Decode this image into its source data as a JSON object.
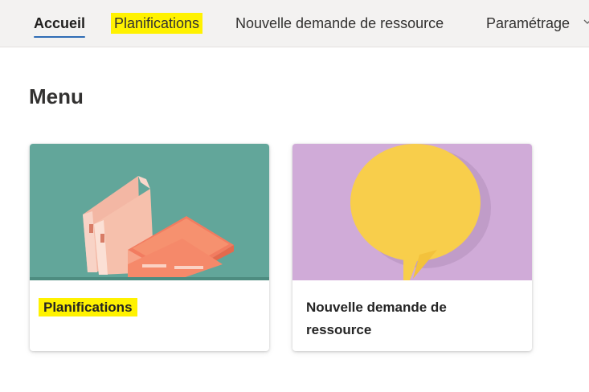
{
  "nav": {
    "items": [
      {
        "label": "Accueil",
        "active": true
      },
      {
        "label": "Planifications",
        "highlighted": true
      },
      {
        "label": "Nouvelle demande de ressource"
      },
      {
        "label": "Paramétrage",
        "has_dropdown": true
      }
    ]
  },
  "main": {
    "title": "Menu",
    "cards": [
      {
        "label": "Planifications",
        "image": "binders-illustration",
        "highlighted": true
      },
      {
        "label": "Nouvelle demande de ressource",
        "image": "speech-bubble-illustration"
      }
    ]
  },
  "colors": {
    "nav_background": "#f3f2f1",
    "active_underline": "#2f6db5",
    "highlight": "#fff200",
    "card1_background": "#62a69a",
    "card2_background": "#d0abd8",
    "binder_color": "#f59378",
    "bubble_color": "#f8ce4b"
  }
}
